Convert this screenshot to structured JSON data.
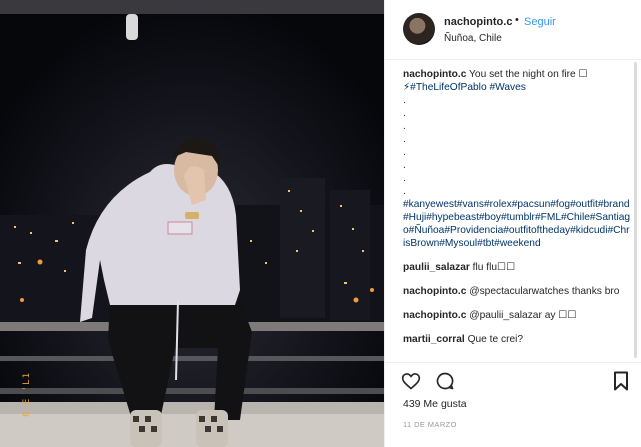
{
  "photo": {
    "date_stamp": "8 E 'L1"
  },
  "header": {
    "username": "nachopinto.c",
    "separator": "•",
    "follow_label": "Seguir",
    "location": "Ñuñoa, Chile"
  },
  "caption": {
    "username": "nachopinto.c",
    "text": "You set the night on fire ☐",
    "tags_line1": "⚡#TheLifeOfPablo #Waves",
    "dots": [
      ".",
      ".",
      ".",
      ".",
      ".",
      ".",
      ".",
      "."
    ],
    "hashtags": "#kanyewest#vans#rolex#pacsun#fog#outfit#brand#Huji#hypebeast#boy#tumblr#FML#Chile#Santiago#Ñuñoa#Providencia#outfitoftheday#kidcudi#ChrisBrown#Mysoul#tbt#weekend"
  },
  "comments": [
    {
      "username": "paulii_salazar",
      "text": "flu flu☐☐"
    },
    {
      "username": "nachopinto.c",
      "text": "@spectacularwatches thanks bro"
    },
    {
      "username": "nachopinto.c",
      "text": "@paulii_salazar ay ☐☐"
    },
    {
      "username": "martii_corral",
      "text": "Que te crei?"
    }
  ],
  "actions": {
    "like_icon": "heart-icon",
    "comment_icon": "comment-icon",
    "save_icon": "bookmark-icon",
    "likes": "439 Me gusta",
    "time": "11 DE MARZO"
  }
}
